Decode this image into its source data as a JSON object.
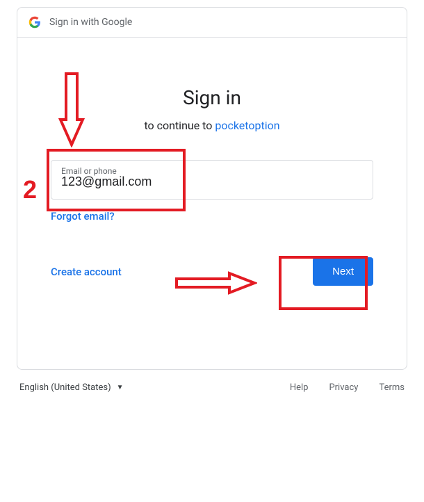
{
  "header": {
    "title": "Sign in with Google"
  },
  "main": {
    "heading": "Sign in",
    "subheading_prefix": "to continue to ",
    "app_name": "pocketoption",
    "email_label": "Email or phone",
    "email_value": "123@gmail.com",
    "forgot_email": "Forgot email?",
    "create_account": "Create account",
    "next": "Next"
  },
  "footer": {
    "language": "English (United States)",
    "help": "Help",
    "privacy": "Privacy",
    "terms": "Terms"
  },
  "annotations": {
    "step_number": "2"
  }
}
